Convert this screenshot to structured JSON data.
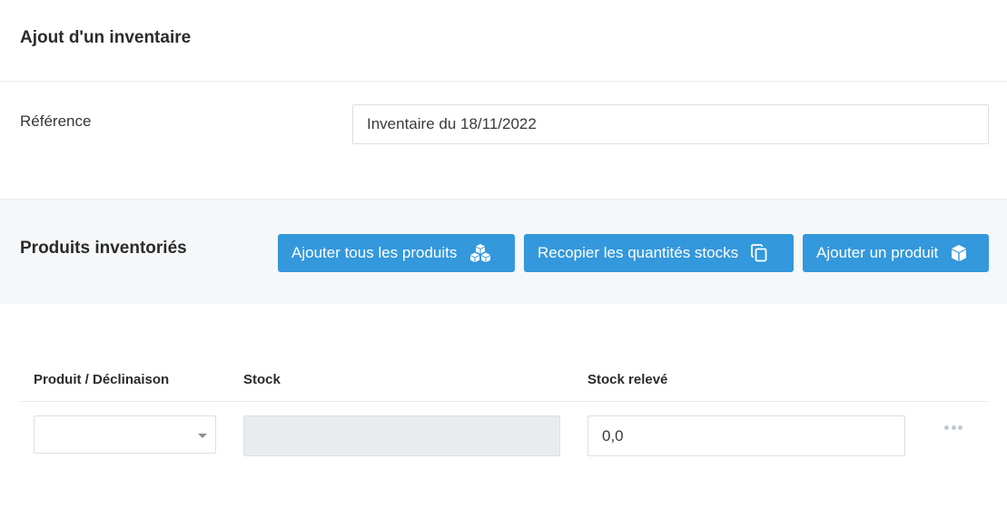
{
  "header": {
    "title": "Ajout d'un inventaire"
  },
  "reference": {
    "label": "Référence",
    "value": "Inventaire du 18/11/2022"
  },
  "products": {
    "title": "Produits inventoriés",
    "buttons": {
      "add_all": {
        "label": "Ajouter tous les produits",
        "icon": "cubes-icon"
      },
      "copy_stock": {
        "label": "Recopier les quantités stocks",
        "icon": "copy-icon"
      },
      "add_one": {
        "label": "Ajouter un produit",
        "icon": "cube-icon"
      }
    },
    "accent_color": "#3398dc"
  },
  "table": {
    "columns": [
      "Produit / Déclinaison",
      "Stock",
      "Stock relevé"
    ],
    "rows": [
      {
        "product": "",
        "stock": "",
        "counted": "0,0"
      }
    ]
  }
}
